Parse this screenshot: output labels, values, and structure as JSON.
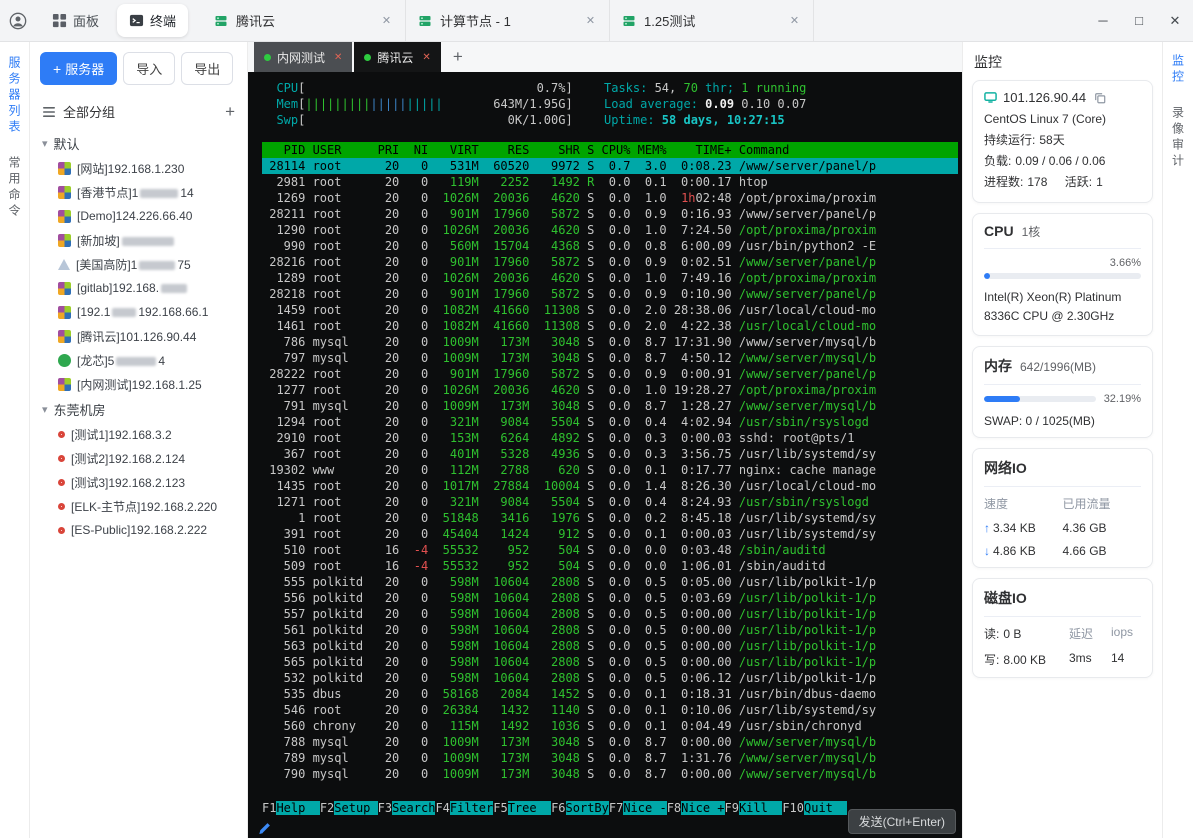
{
  "titlebar": {
    "tabs": [
      {
        "label": "面板",
        "icon": "dashboard-icon",
        "active": false
      },
      {
        "label": "终端",
        "icon": "terminal-icon",
        "active": true
      }
    ],
    "sessions": [
      {
        "label": "腾讯云"
      },
      {
        "label": "计算节点 - 1"
      },
      {
        "label": "1.25测试"
      }
    ],
    "window": {
      "minimize": "─",
      "maximize": "□",
      "close": "✕"
    }
  },
  "left_strip": [
    {
      "label": "服务器列表",
      "active": true
    },
    {
      "label": "常用命令",
      "active": false
    }
  ],
  "sidebar": {
    "server_button": "服务器",
    "import_button": "导入",
    "export_button": "导出",
    "all_groups": "全部分组",
    "groups": [
      {
        "name": "默认",
        "servers": [
          {
            "icon": "centos-icon",
            "segments": [
              {
                "t": "[网站]192.168.1.230"
              }
            ]
          },
          {
            "icon": "centos-icon",
            "segments": [
              {
                "t": "[香港节点]1"
              },
              {
                "m": 38
              },
              {
                "t": "14"
              }
            ]
          },
          {
            "icon": "centos-icon",
            "segments": [
              {
                "t": "[Demo]124.226.66.40"
              }
            ]
          },
          {
            "icon": "centos-icon",
            "segments": [
              {
                "t": "[新加坡]"
              },
              {
                "m": 52
              }
            ]
          },
          {
            "icon": "alpine-icon",
            "segments": [
              {
                "t": "[美国高防]1"
              },
              {
                "m": 36
              },
              {
                "t": "75"
              }
            ]
          },
          {
            "icon": "centos-icon",
            "segments": [
              {
                "t": "[gitlab]192.168."
              },
              {
                "m": 26
              }
            ]
          },
          {
            "icon": "centos-icon",
            "segments": [
              {
                "t": "[192.1"
              },
              {
                "m": 24
              },
              {
                "t": "192.168.66.1"
              }
            ]
          },
          {
            "icon": "centos-icon",
            "segments": [
              {
                "t": "[腾讯云]101.126.90.44"
              }
            ]
          },
          {
            "icon": "loongson-icon",
            "segments": [
              {
                "t": "[龙芯]5"
              },
              {
                "m": 40
              },
              {
                "t": "4"
              }
            ]
          },
          {
            "icon": "centos-icon",
            "segments": [
              {
                "t": "[内网测试]192.168.1.25"
              }
            ]
          }
        ]
      },
      {
        "name": "东莞机房",
        "servers": [
          {
            "icon": "redhat-icon",
            "segments": [
              {
                "t": "[测试1]192.168.3.2"
              }
            ]
          },
          {
            "icon": "redhat-icon",
            "segments": [
              {
                "t": "[测试2]192.168.2.124"
              }
            ]
          },
          {
            "icon": "redhat-icon",
            "segments": [
              {
                "t": "[测试3]192.168.2.123"
              }
            ]
          },
          {
            "icon": "redhat-icon",
            "segments": [
              {
                "t": "[ELK-主节点]192.168.2.220"
              }
            ]
          },
          {
            "icon": "redhat-icon",
            "segments": [
              {
                "t": "[ES-Public]192.168.2.222"
              }
            ]
          }
        ]
      }
    ]
  },
  "terminal": {
    "tabs": [
      {
        "label": "内网测试",
        "active": false
      },
      {
        "label": "腾讯云",
        "active": true
      }
    ],
    "add_tab": "+",
    "send_button": "发送(Ctrl+Enter)",
    "htop": {
      "meters": {
        "cpu_label": "CPU",
        "cpu_text": "0.7%",
        "mem_label": "Mem",
        "mem_bar1": "|||||||||",
        "mem_bar2": "|||||",
        "mem_bar3": "|||||",
        "mem_text": "643M/1.95G",
        "swp_label": "Swp",
        "swp_text": "0K/1.00G"
      },
      "stats": {
        "tasks_label": "Tasks:",
        "tasks_count": "54,",
        "threads_count": "70",
        "thr_label": "thr;",
        "running": "1 running",
        "load_label": "Load average:",
        "load_1": "0.09",
        "load_2": "0.10",
        "load_3": "0.07",
        "uptime_label": "Uptime:",
        "uptime_value": "58 days, 10:27:15"
      },
      "columns": [
        "PID",
        "USER",
        "PRI",
        "NI",
        "VIRT",
        "RES",
        "SHR",
        "S",
        "CPU%",
        "MEM%",
        "TIME+",
        "Command"
      ],
      "processes": [
        {
          "p": "28114",
          "u": "root",
          "pr": "20",
          "ni": "0",
          "v": "531M",
          "r": "60520",
          "sh": "9972",
          "s": "S",
          "c": "0.7",
          "m": "3.0",
          "t": "0:08.23",
          "cmd": "/www/server/panel/p",
          "sel": true
        },
        {
          "p": "2981",
          "u": "root",
          "pr": "20",
          "ni": "0",
          "v": "119M",
          "r": "2252",
          "sh": "1492",
          "s": "R",
          "c": "0.0",
          "m": "0.1",
          "t": "0:00.17",
          "cmd": "htop"
        },
        {
          "p": "1269",
          "u": "root",
          "pr": "20",
          "ni": "0",
          "v": "1026M",
          "r": "20036",
          "sh": "4620",
          "s": "S",
          "c": "0.0",
          "m": "1.0",
          "t": "1h02:48",
          "tr": true,
          "cmd": "/opt/proxima/proxim"
        },
        {
          "p": "28211",
          "u": "root",
          "pr": "20",
          "ni": "0",
          "v": "901M",
          "r": "17960",
          "sh": "5872",
          "s": "S",
          "c": "0.0",
          "m": "0.9",
          "t": "0:16.93",
          "cmd": "/www/server/panel/p"
        },
        {
          "p": "1290",
          "u": "root",
          "pr": "20",
          "ni": "0",
          "v": "1026M",
          "r": "20036",
          "sh": "4620",
          "s": "S",
          "c": "0.0",
          "m": "1.0",
          "t": "7:24.50",
          "cmd": "/opt/proxima/proxim",
          "g": true
        },
        {
          "p": "990",
          "u": "root",
          "pr": "20",
          "ni": "0",
          "v": "560M",
          "r": "15704",
          "sh": "4368",
          "s": "S",
          "c": "0.0",
          "m": "0.8",
          "t": "6:00.09",
          "cmd": "/usr/bin/python2 -E"
        },
        {
          "p": "28216",
          "u": "root",
          "pr": "20",
          "ni": "0",
          "v": "901M",
          "r": "17960",
          "sh": "5872",
          "s": "S",
          "c": "0.0",
          "m": "0.9",
          "t": "0:02.51",
          "cmd": "/www/server/panel/p",
          "g": true
        },
        {
          "p": "1289",
          "u": "root",
          "pr": "20",
          "ni": "0",
          "v": "1026M",
          "r": "20036",
          "sh": "4620",
          "s": "S",
          "c": "0.0",
          "m": "1.0",
          "t": "7:49.16",
          "cmd": "/opt/proxima/proxim",
          "g": true
        },
        {
          "p": "28218",
          "u": "root",
          "pr": "20",
          "ni": "0",
          "v": "901M",
          "r": "17960",
          "sh": "5872",
          "s": "S",
          "c": "0.0",
          "m": "0.9",
          "t": "0:10.90",
          "cmd": "/www/server/panel/p",
          "g": true
        },
        {
          "p": "1459",
          "u": "root",
          "pr": "20",
          "ni": "0",
          "v": "1082M",
          "r": "41660",
          "sh": "11308",
          "s": "S",
          "c": "0.0",
          "m": "2.0",
          "t": "28:38.06",
          "cmd": "/usr/local/cloud-mo"
        },
        {
          "p": "1461",
          "u": "root",
          "pr": "20",
          "ni": "0",
          "v": "1082M",
          "r": "41660",
          "sh": "11308",
          "s": "S",
          "c": "0.0",
          "m": "2.0",
          "t": "4:22.38",
          "cmd": "/usr/local/cloud-mo",
          "g": true
        },
        {
          "p": "786",
          "u": "mysql",
          "pr": "20",
          "ni": "0",
          "v": "1009M",
          "r": "173M",
          "sh": "3048",
          "s": "S",
          "c": "0.0",
          "m": "8.7",
          "t": "17:31.90",
          "cmd": "/www/server/mysql/b"
        },
        {
          "p": "797",
          "u": "mysql",
          "pr": "20",
          "ni": "0",
          "v": "1009M",
          "r": "173M",
          "sh": "3048",
          "s": "S",
          "c": "0.0",
          "m": "8.7",
          "t": "4:50.12",
          "cmd": "/www/server/mysql/b",
          "g": true
        },
        {
          "p": "28222",
          "u": "root",
          "pr": "20",
          "ni": "0",
          "v": "901M",
          "r": "17960",
          "sh": "5872",
          "s": "S",
          "c": "0.0",
          "m": "0.9",
          "t": "0:00.91",
          "cmd": "/www/server/panel/p",
          "g": true
        },
        {
          "p": "1277",
          "u": "root",
          "pr": "20",
          "ni": "0",
          "v": "1026M",
          "r": "20036",
          "sh": "4620",
          "s": "S",
          "c": "0.0",
          "m": "1.0",
          "t": "19:28.27",
          "cmd": "/opt/proxima/proxim",
          "g": true
        },
        {
          "p": "791",
          "u": "mysql",
          "pr": "20",
          "ni": "0",
          "v": "1009M",
          "r": "173M",
          "sh": "3048",
          "s": "S",
          "c": "0.0",
          "m": "8.7",
          "t": "1:28.27",
          "cmd": "/www/server/mysql/b",
          "g": true
        },
        {
          "p": "1294",
          "u": "root",
          "pr": "20",
          "ni": "0",
          "v": "321M",
          "r": "9084",
          "sh": "5504",
          "s": "S",
          "c": "0.0",
          "m": "0.4",
          "t": "4:02.94",
          "cmd": "/usr/sbin/rsyslogd",
          "g": true
        },
        {
          "p": "2910",
          "u": "root",
          "pr": "20",
          "ni": "0",
          "v": "153M",
          "r": "6264",
          "sh": "4892",
          "s": "S",
          "c": "0.0",
          "m": "0.3",
          "t": "0:00.03",
          "cmd": "sshd: root@pts/1"
        },
        {
          "p": "367",
          "u": "root",
          "pr": "20",
          "ni": "0",
          "v": "401M",
          "r": "5328",
          "sh": "4936",
          "s": "S",
          "c": "0.0",
          "m": "0.3",
          "t": "3:56.75",
          "cmd": "/usr/lib/systemd/sy"
        },
        {
          "p": "19302",
          "u": "www",
          "pr": "20",
          "ni": "0",
          "v": "112M",
          "r": "2788",
          "sh": "620",
          "s": "S",
          "c": "0.0",
          "m": "0.1",
          "t": "0:17.77",
          "cmd": "nginx: cache manage"
        },
        {
          "p": "1435",
          "u": "root",
          "pr": "20",
          "ni": "0",
          "v": "1017M",
          "r": "27884",
          "sh": "10004",
          "s": "S",
          "c": "0.0",
          "m": "1.4",
          "t": "8:26.30",
          "cmd": "/usr/local/cloud-mo"
        },
        {
          "p": "1271",
          "u": "root",
          "pr": "20",
          "ni": "0",
          "v": "321M",
          "r": "9084",
          "sh": "5504",
          "s": "S",
          "c": "0.0",
          "m": "0.4",
          "t": "8:24.93",
          "cmd": "/usr/sbin/rsyslogd",
          "g": true
        },
        {
          "p": "1",
          "u": "root",
          "pr": "20",
          "ni": "0",
          "v": "51848",
          "r": "3416",
          "sh": "1976",
          "s": "S",
          "c": "0.0",
          "m": "0.2",
          "t": "8:45.18",
          "cmd": "/usr/lib/systemd/sy"
        },
        {
          "p": "391",
          "u": "root",
          "pr": "20",
          "ni": "0",
          "v": "45404",
          "r": "1424",
          "sh": "912",
          "s": "S",
          "c": "0.0",
          "m": "0.1",
          "t": "0:00.03",
          "cmd": "/usr/lib/systemd/sy"
        },
        {
          "p": "510",
          "u": "root",
          "pr": "16",
          "ni": "-4",
          "v": "55532",
          "r": "952",
          "sh": "504",
          "s": "S",
          "c": "0.0",
          "m": "0.0",
          "t": "0:03.48",
          "cmd": "/sbin/auditd",
          "g": true
        },
        {
          "p": "509",
          "u": "root",
          "pr": "16",
          "ni": "-4",
          "v": "55532",
          "r": "952",
          "sh": "504",
          "s": "S",
          "c": "0.0",
          "m": "0.0",
          "t": "1:06.01",
          "cmd": "/sbin/auditd"
        },
        {
          "p": "555",
          "u": "polkitd",
          "pr": "20",
          "ni": "0",
          "v": "598M",
          "r": "10604",
          "sh": "2808",
          "s": "S",
          "c": "0.0",
          "m": "0.5",
          "t": "0:05.00",
          "cmd": "/usr/lib/polkit-1/p"
        },
        {
          "p": "556",
          "u": "polkitd",
          "pr": "20",
          "ni": "0",
          "v": "598M",
          "r": "10604",
          "sh": "2808",
          "s": "S",
          "c": "0.0",
          "m": "0.5",
          "t": "0:03.69",
          "cmd": "/usr/lib/polkit-1/p",
          "g": true
        },
        {
          "p": "557",
          "u": "polkitd",
          "pr": "20",
          "ni": "0",
          "v": "598M",
          "r": "10604",
          "sh": "2808",
          "s": "S",
          "c": "0.0",
          "m": "0.5",
          "t": "0:00.00",
          "cmd": "/usr/lib/polkit-1/p",
          "g": true
        },
        {
          "p": "561",
          "u": "polkitd",
          "pr": "20",
          "ni": "0",
          "v": "598M",
          "r": "10604",
          "sh": "2808",
          "s": "S",
          "c": "0.0",
          "m": "0.5",
          "t": "0:00.00",
          "cmd": "/usr/lib/polkit-1/p",
          "g": true
        },
        {
          "p": "563",
          "u": "polkitd",
          "pr": "20",
          "ni": "0",
          "v": "598M",
          "r": "10604",
          "sh": "2808",
          "s": "S",
          "c": "0.0",
          "m": "0.5",
          "t": "0:00.00",
          "cmd": "/usr/lib/polkit-1/p",
          "g": true
        },
        {
          "p": "565",
          "u": "polkitd",
          "pr": "20",
          "ni": "0",
          "v": "598M",
          "r": "10604",
          "sh": "2808",
          "s": "S",
          "c": "0.0",
          "m": "0.5",
          "t": "0:00.00",
          "cmd": "/usr/lib/polkit-1/p",
          "g": true
        },
        {
          "p": "532",
          "u": "polkitd",
          "pr": "20",
          "ni": "0",
          "v": "598M",
          "r": "10604",
          "sh": "2808",
          "s": "S",
          "c": "0.0",
          "m": "0.5",
          "t": "0:06.12",
          "cmd": "/usr/lib/polkit-1/p"
        },
        {
          "p": "535",
          "u": "dbus",
          "pr": "20",
          "ni": "0",
          "v": "58168",
          "r": "2084",
          "sh": "1452",
          "s": "S",
          "c": "0.0",
          "m": "0.1",
          "t": "0:18.31",
          "cmd": "/usr/bin/dbus-daemo"
        },
        {
          "p": "546",
          "u": "root",
          "pr": "20",
          "ni": "0",
          "v": "26384",
          "r": "1432",
          "sh": "1140",
          "s": "S",
          "c": "0.0",
          "m": "0.1",
          "t": "0:10.06",
          "cmd": "/usr/lib/systemd/sy"
        },
        {
          "p": "560",
          "u": "chrony",
          "pr": "20",
          "ni": "0",
          "v": "115M",
          "r": "1492",
          "sh": "1036",
          "s": "S",
          "c": "0.0",
          "m": "0.1",
          "t": "0:04.49",
          "cmd": "/usr/sbin/chronyd"
        },
        {
          "p": "788",
          "u": "mysql",
          "pr": "20",
          "ni": "0",
          "v": "1009M",
          "r": "173M",
          "sh": "3048",
          "s": "S",
          "c": "0.0",
          "m": "8.7",
          "t": "0:00.00",
          "cmd": "/www/server/mysql/b",
          "g": true
        },
        {
          "p": "789",
          "u": "mysql",
          "pr": "20",
          "ni": "0",
          "v": "1009M",
          "r": "173M",
          "sh": "3048",
          "s": "S",
          "c": "0.0",
          "m": "8.7",
          "t": "1:31.76",
          "cmd": "/www/server/mysql/b",
          "g": true
        },
        {
          "p": "790",
          "u": "mysql",
          "pr": "20",
          "ni": "0",
          "v": "1009M",
          "r": "173M",
          "sh": "3048",
          "s": "S",
          "c": "0.0",
          "m": "8.7",
          "t": "0:00.00",
          "cmd": "/www/server/mysql/b",
          "g": true
        }
      ],
      "fkeys": [
        {
          "key": "F1",
          "label": "Help"
        },
        {
          "key": "F2",
          "label": "Setup"
        },
        {
          "key": "F3",
          "label": "Search"
        },
        {
          "key": "F4",
          "label": "Filter"
        },
        {
          "key": "F5",
          "label": "Tree"
        },
        {
          "key": "F6",
          "label": "SortBy"
        },
        {
          "key": "F7",
          "label": "Nice -"
        },
        {
          "key": "F8",
          "label": "Nice +"
        },
        {
          "key": "F9",
          "label": "Kill"
        },
        {
          "key": "F10",
          "label": "Quit"
        }
      ]
    }
  },
  "monitor": {
    "title": "监控",
    "server": {
      "host": "101.126.90.44",
      "os": "CentOS Linux 7 (Core)",
      "uptime_label": "持续运行:",
      "uptime": "58天",
      "load_label": "负载:",
      "load": "0.09 / 0.06 / 0.06",
      "proc_label": "进程数:",
      "proc": "178",
      "active_label": "活跃:",
      "active": "1"
    },
    "cpu": {
      "title": "CPU",
      "cores": "1核",
      "percent": "3.66%",
      "percent_value": 3.66,
      "model_line1": "Intel(R) Xeon(R) Platinum",
      "model_line2": "8336C CPU @ 2.30GHz"
    },
    "memory": {
      "title": "内存",
      "usage": "642/1996(MB)",
      "percent": "32.19%",
      "percent_value": 32.19,
      "swap": "SWAP: 0 / 1025(MB)"
    },
    "network": {
      "title": "网络IO",
      "col_speed": "速度",
      "col_traffic": "已用流量",
      "up_arrow": "↑",
      "down_arrow": "↓",
      "up_speed": "3.34 KB",
      "up_total": "4.36 GB",
      "down_speed": "4.86 KB",
      "down_total": "4.66 GB"
    },
    "disk": {
      "title": "磁盘IO",
      "read_label": "读:",
      "read": "0 B",
      "write_label": "写:",
      "write": "8.00 KB",
      "latency_label": "延迟",
      "latency": "3ms",
      "iops_label": "iops",
      "iops": "14"
    }
  },
  "right_strip": [
    {
      "label": "监控",
      "active": true
    },
    {
      "label": "录像审计",
      "active": false
    }
  ]
}
